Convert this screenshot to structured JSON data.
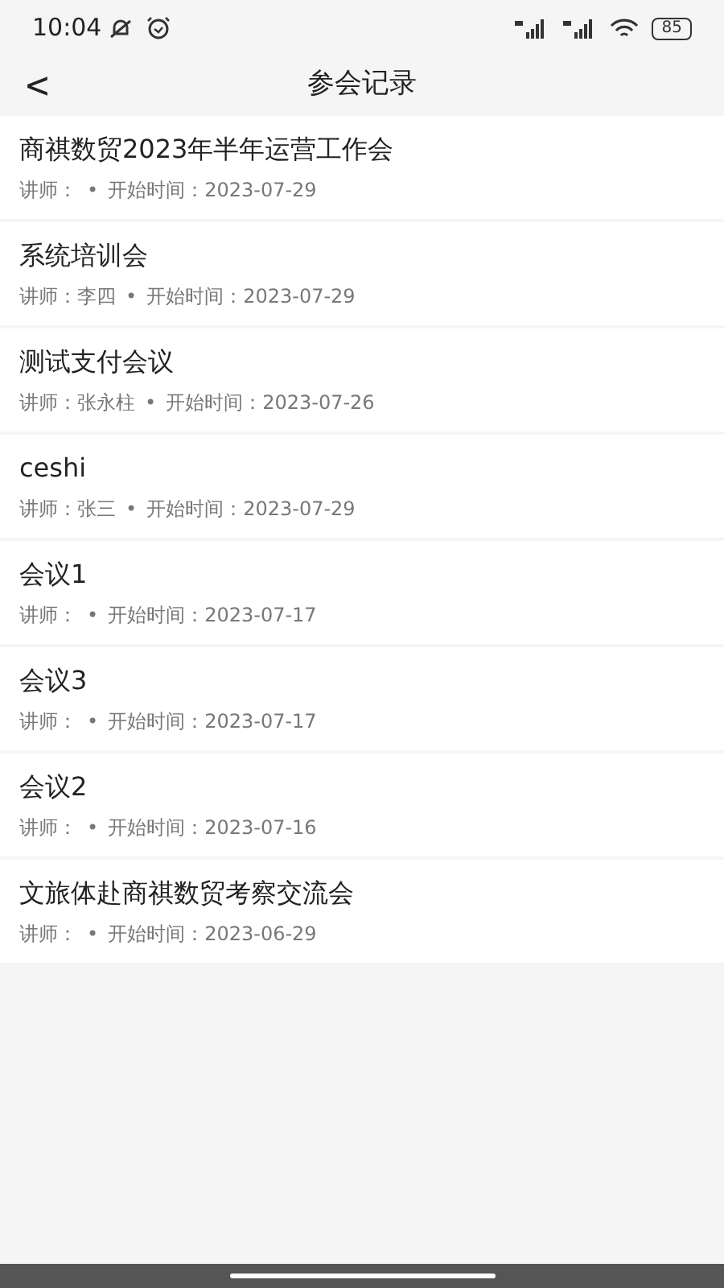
{
  "status_bar": {
    "time": "10:04",
    "battery": "85"
  },
  "header": {
    "back": "<",
    "title": "参会记录"
  },
  "meetings": [
    {
      "title": "商祺数贸2023年半年运营工作会",
      "lecturer_label": "讲师：",
      "separator": "•",
      "start_label": "开始时间：",
      "date": "2023-07-29"
    },
    {
      "title": "系统培训会",
      "lecturer_label": "讲师：",
      "lecturer": "李四",
      "separator": "•",
      "start_label": "开始时间：",
      "date": "2023-07-29"
    },
    {
      "title": "测试支付会议",
      "lecturer_label": "讲师：",
      "lecturer": "张永柱",
      "separator": "•",
      "start_label": "开始时间：",
      "date": "2023-07-26"
    },
    {
      "title": "ceshi",
      "lecturer_label": "讲师：",
      "lecturer": "张三",
      "separator": "•",
      "start_label": "开始时间：",
      "date": "2023-07-29"
    },
    {
      "title": "会议1",
      "lecturer_label": "讲师：",
      "separator": "•",
      "start_label": "开始时间：",
      "date": "2023-07-17"
    },
    {
      "title": "会议3",
      "lecturer_label": "讲师：",
      "separator": "•",
      "start_label": "开始时间：",
      "date": "2023-07-17"
    },
    {
      "title": "会议2",
      "lecturer_label": "讲师：",
      "separator": "•",
      "start_label": "开始时间：",
      "date": "2023-07-16"
    },
    {
      "title": "文旅体赴商祺数贸考察交流会",
      "lecturer_label": "讲师：",
      "separator": "•",
      "start_label": "开始时间：",
      "date": "2023-06-29"
    }
  ]
}
